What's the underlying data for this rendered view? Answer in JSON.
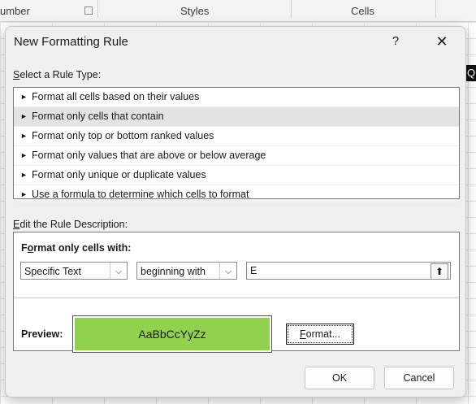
{
  "ribbon": {
    "groups": [
      "umber",
      "Styles",
      "Cells"
    ]
  },
  "background": {
    "cell_char": "Q"
  },
  "dialog": {
    "title": "New Formatting Rule",
    "help": "?",
    "close": "✕"
  },
  "rule_type": {
    "label_underlined": "S",
    "label_rest": "elect a Rule Type:",
    "selected_index": 1,
    "items": [
      "Format all cells based on their values",
      "Format only cells that contain",
      "Format only top or bottom ranked values",
      "Format only values that are above or below average",
      "Format only unique or duplicate values",
      "Use a formula to determine which cells to format"
    ]
  },
  "description": {
    "label_underlined": "E",
    "label_rest": "dit the Rule Description:",
    "title_underlined": "o",
    "title_pre": "F",
    "title_rest": "rmat only cells with:",
    "condition_select": "Specific Text",
    "operator_select": "beginning with",
    "value": "E",
    "preview_label": "Preview:",
    "preview_text": "AaBbCcYyZz",
    "preview_fill": "#92d050",
    "format_button_underlined": "F",
    "format_button_rest": "ormat..."
  },
  "buttons": {
    "ok": "OK",
    "cancel": "Cancel"
  }
}
